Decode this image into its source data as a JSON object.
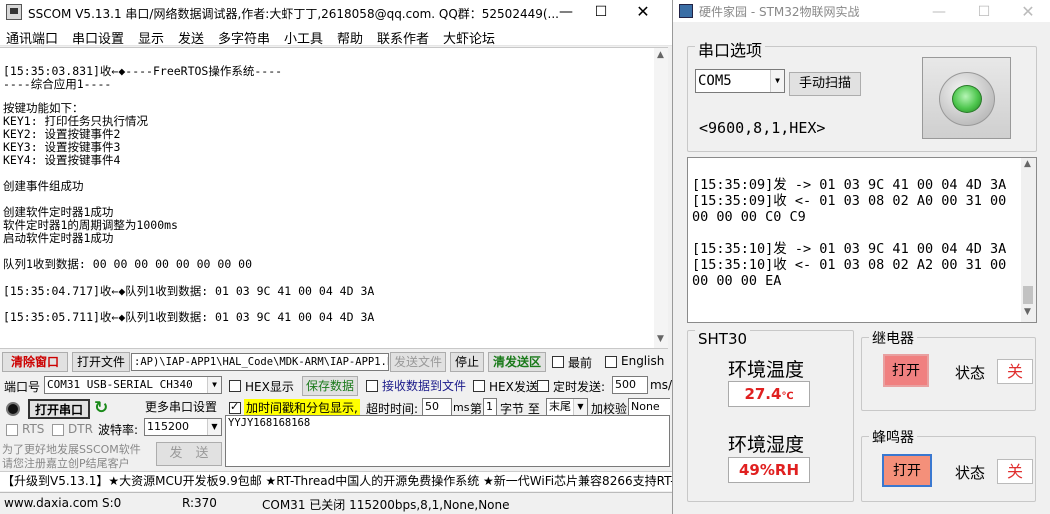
{
  "sscom": {
    "title": "SSCOM V5.13.1 串口/网络数据调试器,作者:大虾丁丁,2618058@qq.com. QQ群：52502449(...",
    "menu": [
      "通讯端口",
      "串口设置",
      "显示",
      "发送",
      "多字符串",
      "小工具",
      "帮助",
      "联系作者",
      "大虾论坛"
    ],
    "recv_lines": [
      "[15:35:03.831]收←◆----FreeRTOS操作系统----",
      "----综合应用1----",
      "",
      "按键功能如下：",
      "KEY1: 打印任务只执行情况",
      "KEY2: 设置按键事件2",
      "KEY3: 设置按键事件3",
      "KEY4: 设置按键事件4",
      "",
      "创建事件组成功",
      "",
      "创建软件定时器1成功",
      "软件定时器1的周期调整为1000ms",
      "启动软件定时器1成功",
      "",
      "队列1收到数据: 00 00 00 00 00 00 00 00",
      "",
      "[15:35:04.717]收←◆队列1收到数据: 01 03 9C 41 00 04 4D 3A",
      "",
      "[15:35:05.711]收←◆队列1收到数据: 01 03 9C 41 00 04 4D 3A"
    ],
    "toolbar": {
      "clear_window": "清除窗口",
      "open_file": "打开文件",
      "file_path": ":AP)\\IAP-APP1\\HAL_Code\\MDK-ARM\\IAP-APP1.bin",
      "send_file": "发送文件",
      "stop": "停止",
      "clear_send": "清发送区",
      "topmost": "最前",
      "english": "English"
    },
    "port": {
      "label": "端口号",
      "value": "COM31 USB-SERIAL CH340",
      "hex_display": "HEX显示",
      "save_data": "保存数据",
      "recv_to_file": "接收数据到文件",
      "hex_send": "HEX发送",
      "timed_send": "定时发送:",
      "interval": "500",
      "interval_unit": "ms/"
    },
    "row2": {
      "open_port": "打开串口",
      "more_settings": "更多串口设置",
      "timestamp": "加时间戳和分包显示,",
      "timeout_label": "超时时间:",
      "timeout": "50",
      "timeout_unit": "ms",
      "nth_label": "第",
      "nth": "1",
      "byte_label": "字节 至",
      "end": "末尾",
      "checksum_label": "加校验",
      "checksum": "None"
    },
    "row3": {
      "rts": "RTS",
      "dtr": "DTR",
      "baud_label": "波特率:",
      "baud": "115200",
      "send_text": "YYJY168168168"
    },
    "promo": [
      "为了更好地发展SSCOM软件",
      "请您注册嘉立创P结尾客户"
    ],
    "send_button": "发　送",
    "ticker": "【升级到V5.13.1】★大资源MCU开发板9.9包邮 ★RT-Thread中国人的开源免费操作系统 ★新一代WiFi芯片兼容8266支持RT-Th",
    "status": {
      "site": "www.daxia.com",
      "s": "S:0",
      "r": "R:370",
      "port_status": "COM31 已关闭  115200bps,8,1,None,None"
    }
  },
  "iot": {
    "title": "硬件家园 - STM32物联网实战",
    "serial_group": "串口选项",
    "port": "COM5",
    "scan_button": "手动扫描",
    "params": "<9600,8,1,HEX>",
    "log_lines": [
      "",
      "[15:35:09]发 -> 01 03 9C 41 00 04 4D 3A",
      "[15:35:09]收 <- 01 03 08 02 A0 00 31 00",
      "00 00 00 C0 C9",
      "",
      "[15:35:10]发 -> 01 03 9C 41 00 04 4D 3A",
      "[15:35:10]收 <- 01 03 08 02 A2 00 31 00",
      "00 00 00 EA"
    ],
    "sensor_title": "SHT30",
    "temp_label": "环境温度",
    "temp_value": "27.4",
    "temp_unit": "℃",
    "hum_label": "环境湿度",
    "hum_value": "49%RH",
    "relay_label": "继电器",
    "relay_open": "打开",
    "relay_state_label": "状态",
    "relay_state": "关",
    "buzzer_label": "蜂鸣器",
    "buzzer_open": "打开",
    "buzzer_state_label": "状态",
    "buzzer_state": "关"
  },
  "colors": {
    "accent_green": "#2f8a2f",
    "highlight_yellow": "#ffff00",
    "value_red": "#e02020",
    "led_green": "#4ec64e"
  }
}
